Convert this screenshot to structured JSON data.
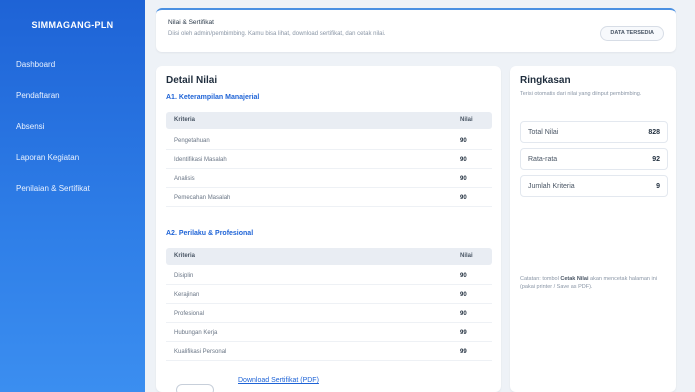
{
  "sidebar": {
    "brand": "SIMMAGANG-PLN",
    "items": [
      {
        "label": "Dashboard"
      },
      {
        "label": "Pendaftaran"
      },
      {
        "label": "Absensi"
      },
      {
        "label": "Laporan Kegiatan"
      },
      {
        "label": "Penilaian & Sertifikat"
      }
    ]
  },
  "header": {
    "title": "Nilai & Sertifikat",
    "subtitle": "Diisi oleh admin/pembimbing. Kamu bisa lihat, download sertifikat, dan cetak nilai.",
    "badge": "DATA TERSEDIA"
  },
  "detail": {
    "title": "Detail Nilai",
    "section_a1": "A1. Keterampilan Manajerial",
    "section_a2": "A2. Perilaku & Profesional",
    "col_kriteria": "Kriteria",
    "col_nilai": "Nilai",
    "rows_a1": [
      {
        "kriteria": "Pengetahuan",
        "nilai": "90"
      },
      {
        "kriteria": "Identifikasi Masalah",
        "nilai": "90"
      },
      {
        "kriteria": "Analisis",
        "nilai": "90"
      },
      {
        "kriteria": "Pemecahan Masalah",
        "nilai": "90"
      }
    ],
    "rows_a2": [
      {
        "kriteria": "Disiplin",
        "nilai": "90"
      },
      {
        "kriteria": "Kerajinan",
        "nilai": "90"
      },
      {
        "kriteria": "Profesional",
        "nilai": "90"
      },
      {
        "kriteria": "Hubungan Kerja",
        "nilai": "99"
      },
      {
        "kriteria": "Kualifikasi Personal",
        "nilai": "99"
      }
    ],
    "download_label": "Download Sertifikat (PDF)"
  },
  "summary": {
    "title": "Ringkasan",
    "subtitle": "Terisi otomatis dari nilai yang diinput pembimbing.",
    "total_label": "Total Nilai",
    "total_value": "828",
    "avg_label": "Rata-rata",
    "avg_value": "92",
    "count_label": "Jumlah Kriteria",
    "count_value": "9",
    "note_prefix": "Catatan: tombol",
    "note_bold": "Cetak Nilai",
    "note_suffix": "akan mencetak halaman ini (pakai printer / Save as PDF)."
  }
}
